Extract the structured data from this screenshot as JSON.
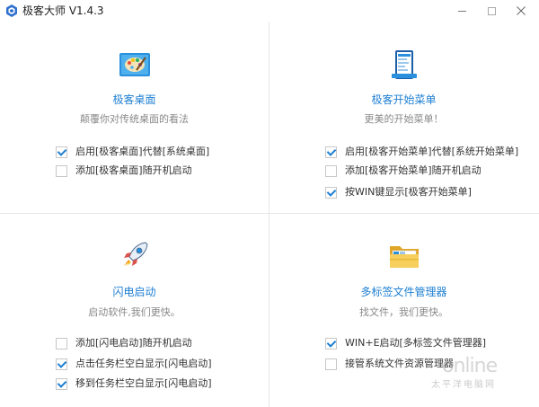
{
  "window": {
    "title": "极客大师 V1.4.3",
    "controls": [
      "minimize",
      "maximize",
      "close"
    ]
  },
  "colors": {
    "accent": "#1e7fd2",
    "divider": "#e6e6e6",
    "subtitle": "#888888"
  },
  "panels": [
    {
      "icon": "desktop-palette-icon",
      "title": "极客桌面",
      "subtitle": "颠覆你对传统桌面的看法",
      "options": [
        {
          "label": "启用[极客桌面]代替[系统桌面]",
          "checked": true
        },
        {
          "label": "添加[极客桌面]随开机启动",
          "checked": false
        }
      ]
    },
    {
      "icon": "start-menu-icon",
      "title": "极客开始菜单",
      "subtitle": "更美的开始菜单！",
      "options": [
        {
          "label": "启用[极客开始菜单]代替[系统开始菜单]",
          "checked": true
        },
        {
          "label": "添加[极客开始菜单]随开机启动",
          "checked": false
        },
        {
          "label": "按WIN键显示[极客开始菜单]",
          "checked": true
        }
      ]
    },
    {
      "icon": "rocket-icon",
      "title": "闪电启动",
      "subtitle": "启动软件,我们更快。",
      "options": [
        {
          "label": "添加[闪电启动]随开机启动",
          "checked": false
        },
        {
          "label": "点击任务栏空白显示[闪电启动]",
          "checked": true
        },
        {
          "label": "移到任务栏空白显示[闪电启动]",
          "checked": true
        }
      ]
    },
    {
      "icon": "folder-icon",
      "title": "多标签文件管理器",
      "subtitle": "找文件，我们更快。",
      "options": [
        {
          "label": "WIN+E启动[多标签文件管理器]",
          "checked": true
        },
        {
          "label": "接管系统文件资源管理器",
          "checked": false
        }
      ]
    }
  ],
  "watermark": {
    "brand": "online",
    "sub": "太平洋电脑网"
  }
}
